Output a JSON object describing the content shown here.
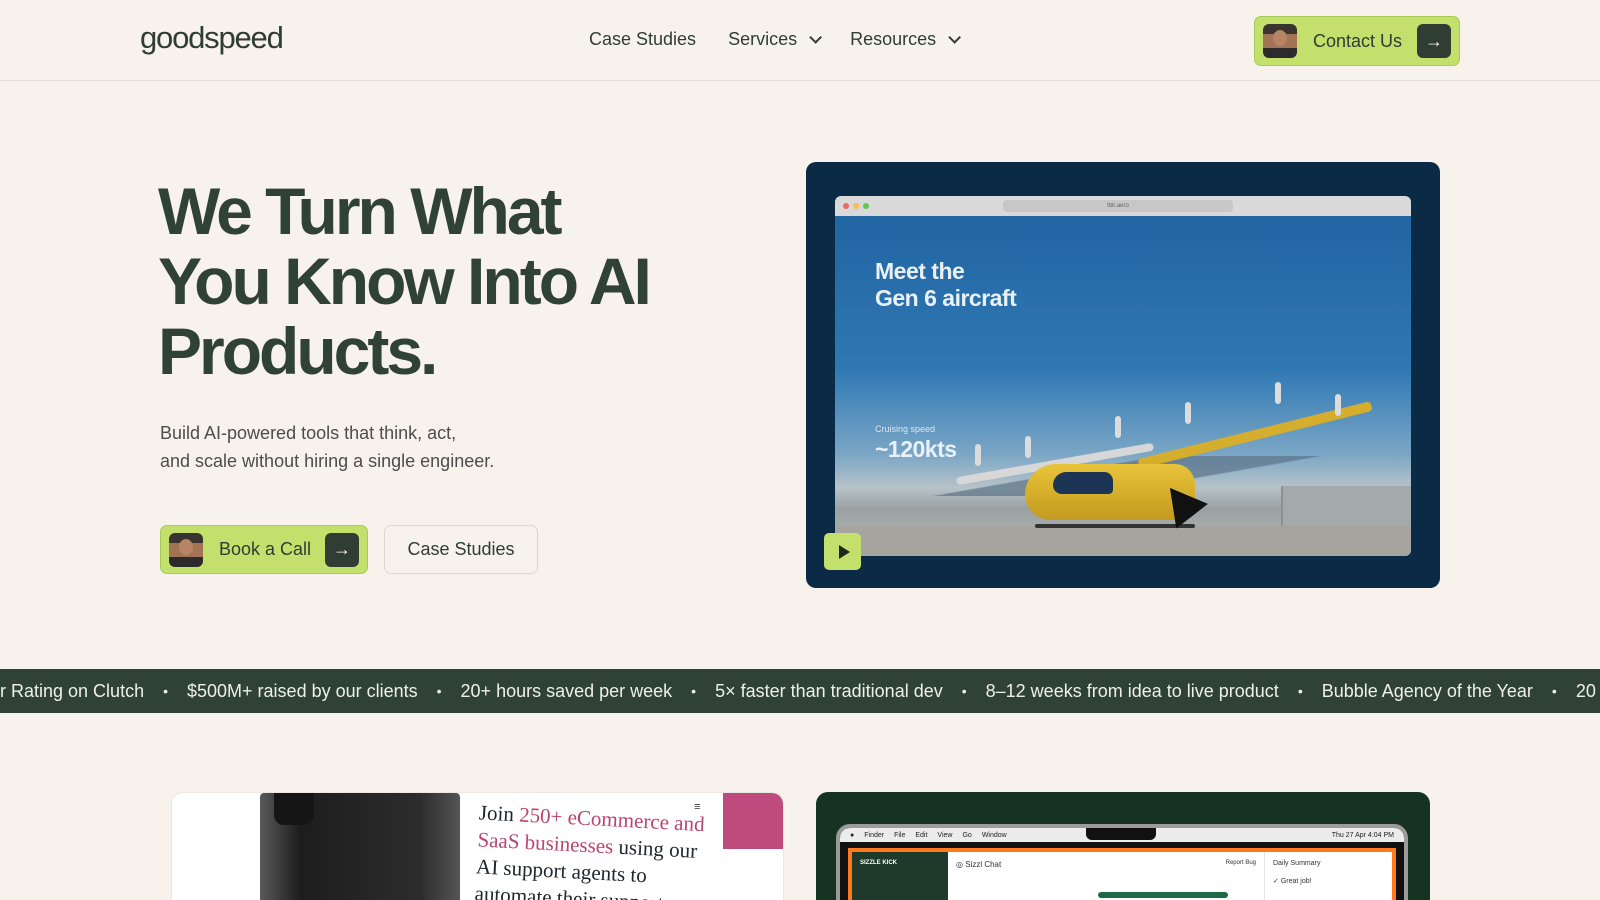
{
  "nav": {
    "logo": "goodspeed",
    "links": [
      {
        "label": "Case Studies",
        "has_dropdown": false
      },
      {
        "label": "Services",
        "has_dropdown": true
      },
      {
        "label": "Resources",
        "has_dropdown": true
      }
    ],
    "contact_label": "Contact Us"
  },
  "hero": {
    "title": "We Turn What You Know Into AI Products.",
    "subtitle_line1": "Build AI-powered tools that think, act,",
    "subtitle_line2": "and scale without hiring a single engineer.",
    "book_label": "Book a Call",
    "case_label": "Case Studies"
  },
  "video": {
    "url": "tbk.aero",
    "headline_line1": "Meet the",
    "headline_line2": "Gen 6 aircraft",
    "stat_label": "Cruising speed",
    "stat_value": "~120kts"
  },
  "ticker": {
    "items": [
      "ar Rating on Clutch",
      "$500M+ raised by our clients",
      "20+ hours saved per week",
      "5× faster than traditional dev",
      "8–12 weeks from idea to live product",
      "Bubble Agency of the Year",
      "20"
    ],
    "separator": "•"
  },
  "card_left": {
    "text_join": "Join ",
    "text_pink": "250+ eCommerce and SaaS businesses",
    "text_rest": " using our AI support agents to automate their support"
  },
  "card_right": {
    "menubar": [
      "Finder",
      "File",
      "Edit",
      "View",
      "Go",
      "Window"
    ],
    "clock": "Thu 27 Apr 4:04 PM",
    "app_brand": "SIZZLE KICK",
    "app_title": "Sizzl Chat",
    "report_bug": "Report Bug",
    "summary_title": "Daily Summary",
    "summary_item": "Great job!"
  },
  "colors": {
    "background": "#f8f2ed",
    "primary_text": "#2f4234",
    "accent_lime": "#c3e06c",
    "ticker_bg": "#2f4234",
    "video_bg": "#0b2a45"
  }
}
